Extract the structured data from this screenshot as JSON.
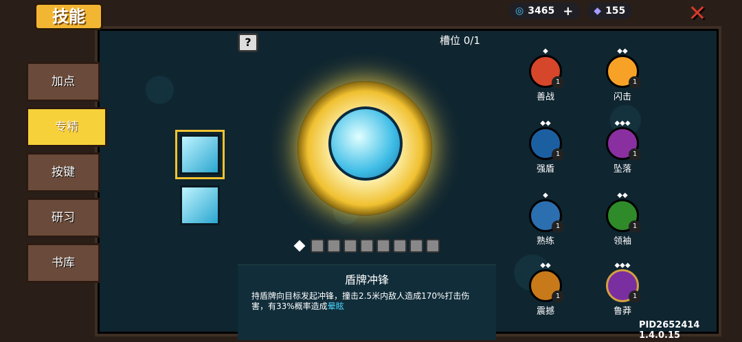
{
  "title": "技能",
  "sidebar": {
    "items": [
      {
        "label": "加点"
      },
      {
        "label": "专精"
      },
      {
        "label": "按键"
      },
      {
        "label": "研习"
      },
      {
        "label": "书库"
      }
    ]
  },
  "currency": {
    "gems": "3465",
    "other": "155"
  },
  "slot_text": "槽位 0/1",
  "skill": {
    "name": "盾牌冲锋",
    "desc": "持盾牌向目标发起冲锋，撞击2.5米内敌人造成170%打击伤害，有33%概率造成",
    "highlight": "晕眩"
  },
  "talents": [
    {
      "label": "善战",
      "badge": "1"
    },
    {
      "label": "闪击",
      "badge": "1"
    },
    {
      "label": "强盾",
      "badge": "1"
    },
    {
      "label": "坠落",
      "badge": "1"
    },
    {
      "label": "熟练",
      "badge": "1"
    },
    {
      "label": "领袖",
      "badge": "1"
    },
    {
      "label": "震撼",
      "badge": "1"
    },
    {
      "label": "鲁莽",
      "badge": "1"
    }
  ],
  "footer": "PID2652414 1.4.0.15"
}
